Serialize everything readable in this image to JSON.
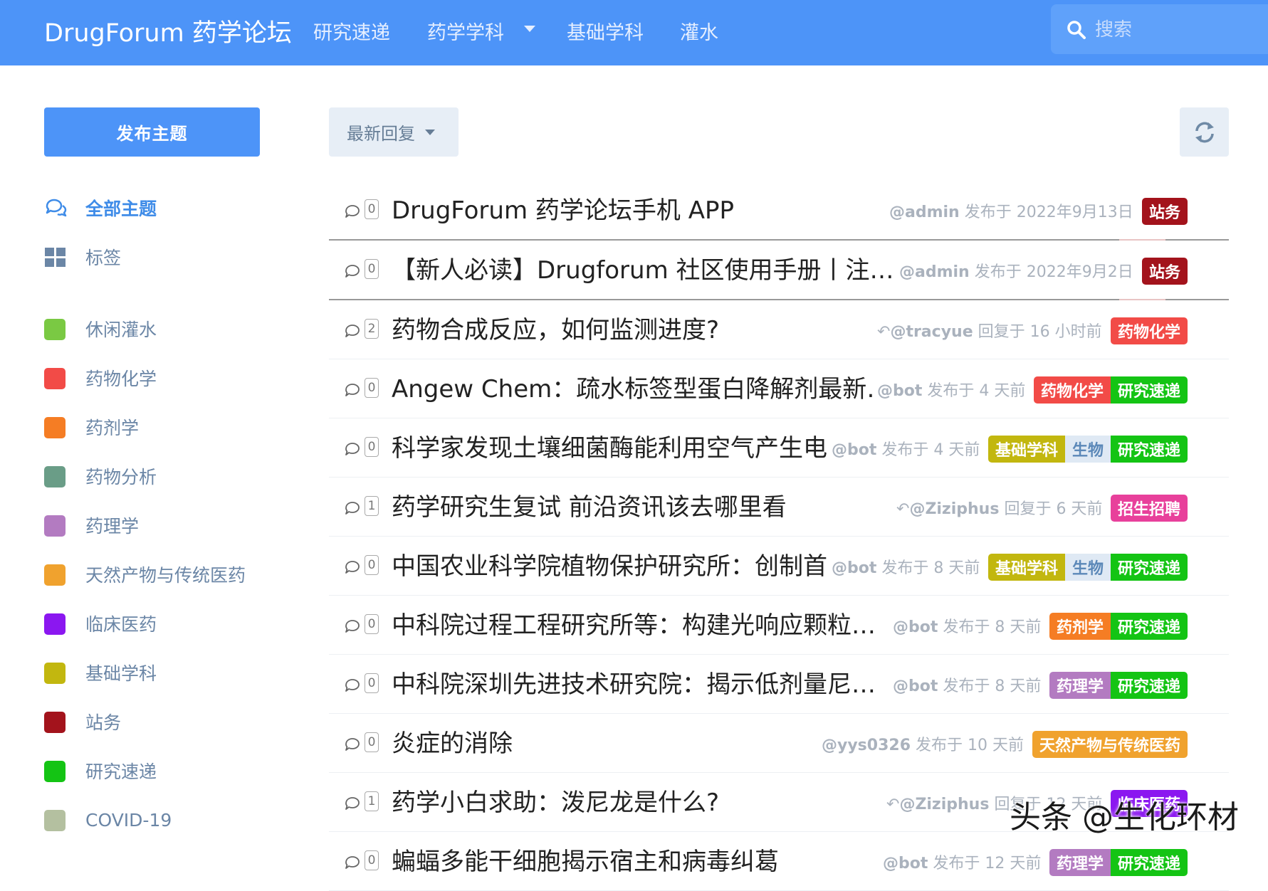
{
  "header": {
    "brand": "DrugForum 药学论坛",
    "nav": [
      {
        "label": "研究速递"
      },
      {
        "label": "药学学科"
      },
      {
        "label": "基础学科"
      },
      {
        "label": "灌水"
      }
    ],
    "search_placeholder": "搜索"
  },
  "sidebar": {
    "new_topic": "发布主题",
    "all_topics": "全部主题",
    "tags": "标签",
    "categories": [
      {
        "label": "休闲灌水",
        "color": "#7ac943"
      },
      {
        "label": "药物化学",
        "color": "#f24b47"
      },
      {
        "label": "药剂学",
        "color": "#f57d24"
      },
      {
        "label": "药物分析",
        "color": "#6a9d87"
      },
      {
        "label": "药理学",
        "color": "#b37bc1"
      },
      {
        "label": "天然产物与传统医药",
        "color": "#f0a22e"
      },
      {
        "label": "临床医药",
        "color": "#8b17f0"
      },
      {
        "label": "基础学科",
        "color": "#c2b70f"
      },
      {
        "label": "站务",
        "color": "#a3131c"
      },
      {
        "label": "研究速递",
        "color": "#14c414"
      },
      {
        "label": "COVID-19",
        "color": "#b4c0a0"
      }
    ]
  },
  "toolbar": {
    "sort_label": "最新回复"
  },
  "topics": [
    {
      "count": "0",
      "title": "DrugForum 药学论坛手机 APP",
      "user": "@admin",
      "action": "发布于 2022年9月13日",
      "reply": false,
      "tags": [
        {
          "label": "站务",
          "color": "#a3131c"
        }
      ]
    },
    {
      "count": "0",
      "title": "【新人必读】Drugforum 社区使用手册丨注…",
      "user": "@admin",
      "action": "发布于 2022年9月2日",
      "reply": false,
      "tags": [
        {
          "label": "站务",
          "color": "#a3131c"
        }
      ]
    },
    {
      "count": "2",
      "title": "药物合成反应，如何监测进度?",
      "user": "@tracyue",
      "action": "回复于 16 小时前",
      "reply": true,
      "tags": [
        {
          "label": "药物化学",
          "color": "#f24b47"
        }
      ]
    },
    {
      "count": "0",
      "title": "Angew Chem：疏水标签型蛋白降解剂最新…",
      "user": "@bot",
      "action": "发布于 4 天前",
      "reply": false,
      "tags": [
        {
          "label": "药物化学",
          "color": "#f24b47"
        },
        {
          "label": "研究速递",
          "color": "#14c414"
        }
      ]
    },
    {
      "count": "0",
      "title": "科学家发现土壤细菌酶能利用空气产生电能",
      "user": "@bot",
      "action": "发布于 4 天前",
      "reply": false,
      "tags": [
        {
          "label": "基础学科",
          "color": "#c2b70f"
        },
        {
          "label": "生物",
          "color": "light"
        },
        {
          "label": "研究速递",
          "color": "#14c414"
        }
      ]
    },
    {
      "count": "1",
      "title": "药学研究生复试 前沿资讯该去哪里看",
      "user": "@Ziziphus",
      "action": "回复于 6 天前",
      "reply": true,
      "tags": [
        {
          "label": "招生招聘",
          "color": "#e8409b"
        }
      ]
    },
    {
      "count": "0",
      "title": "中国农业科学院植物保护研究所：创制首个…",
      "user": "@bot",
      "action": "发布于 8 天前",
      "reply": false,
      "tags": [
        {
          "label": "基础学科",
          "color": "#c2b70f"
        },
        {
          "label": "生物",
          "color": "light"
        },
        {
          "label": "研究速递",
          "color": "#14c414"
        }
      ]
    },
    {
      "count": "0",
      "title": "中科院过程工程研究所等：构建光响应颗粒…",
      "user": "@bot",
      "action": "发布于 8 天前",
      "reply": false,
      "tags": [
        {
          "label": "药剂学",
          "color": "#f57d24"
        },
        {
          "label": "研究速递",
          "color": "#14c414"
        }
      ]
    },
    {
      "count": "0",
      "title": "中科院深圳先进技术研究院：揭示低剂量尼…",
      "user": "@bot",
      "action": "发布于 8 天前",
      "reply": false,
      "tags": [
        {
          "label": "药理学",
          "color": "#b37bc1"
        },
        {
          "label": "研究速递",
          "color": "#14c414"
        }
      ]
    },
    {
      "count": "0",
      "title": "炎症的消除",
      "user": "@yys0326",
      "action": "发布于 10 天前",
      "reply": false,
      "tags": [
        {
          "label": "天然产物与传统医药",
          "color": "#f0a22e"
        }
      ]
    },
    {
      "count": "1",
      "title": "药学小白求助：泼尼龙是什么?",
      "user": "@Ziziphus",
      "action": "回复于 12 天前",
      "reply": true,
      "tags": [
        {
          "label": "临床医药",
          "color": "#8b17f0"
        }
      ]
    },
    {
      "count": "0",
      "title": "蝙蝠多能干细胞揭示宿主和病毒纠葛",
      "user": "@bot",
      "action": "发布于 12 天前",
      "reply": false,
      "tags": [
        {
          "label": "药理学",
          "color": "#b37bc1"
        },
        {
          "label": "研究速递",
          "color": "#14c414"
        }
      ]
    }
  ],
  "watermark": "头条 @生化环材"
}
